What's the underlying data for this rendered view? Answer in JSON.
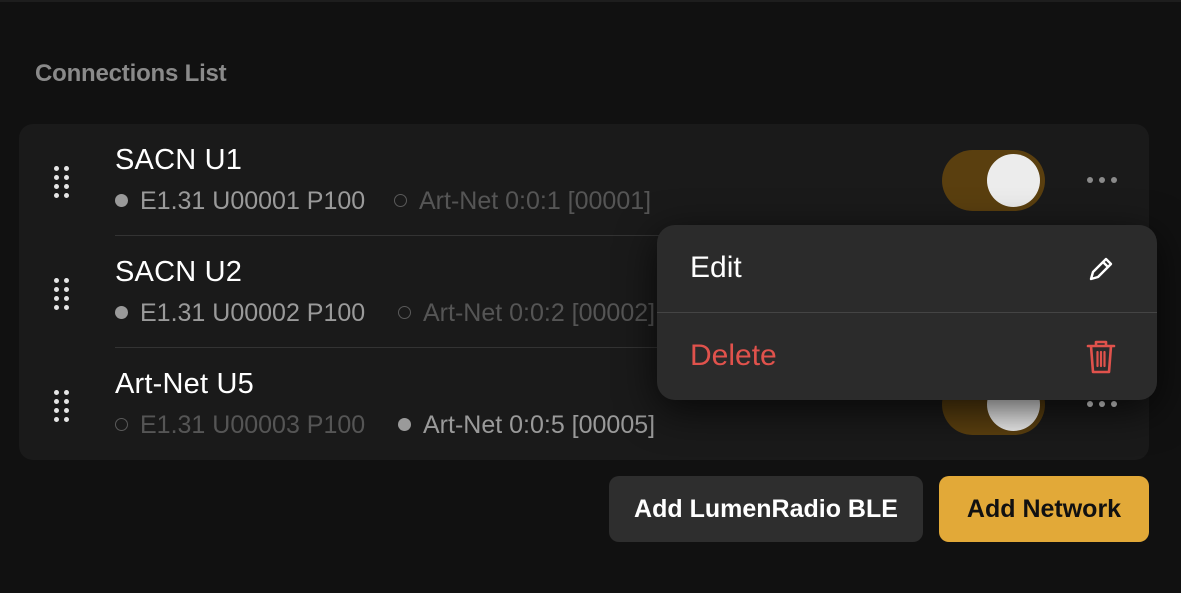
{
  "section_title": "Connections List",
  "connections": [
    {
      "name": "SACN U1",
      "sacn": {
        "label": "E1.31 U00001 P100",
        "active": true
      },
      "artnet": {
        "label": "Art-Net 0:0:1 [00001]",
        "active": false
      },
      "enabled": true
    },
    {
      "name": "SACN U2",
      "sacn": {
        "label": "E1.31 U00002 P100",
        "active": true
      },
      "artnet": {
        "label": "Art-Net 0:0:2 [00002]",
        "active": false
      },
      "enabled": true
    },
    {
      "name": "Art-Net U5",
      "sacn": {
        "label": "E1.31 U00003 P100",
        "active": false
      },
      "artnet": {
        "label": "Art-Net 0:0:5 [00005]",
        "active": true
      },
      "enabled": true
    }
  ],
  "context_menu": {
    "edit": {
      "label": "Edit",
      "icon": "pencil-icon",
      "color": "#ffffff"
    },
    "delete": {
      "label": "Delete",
      "icon": "trash-icon",
      "color": "#e0524c"
    }
  },
  "buttons": {
    "add_ble": "Add LumenRadio BLE",
    "add_network": "Add Network"
  },
  "colors": {
    "accent": "#e2a938",
    "toggle_track": "#5a3f0f",
    "danger": "#e0524c"
  }
}
